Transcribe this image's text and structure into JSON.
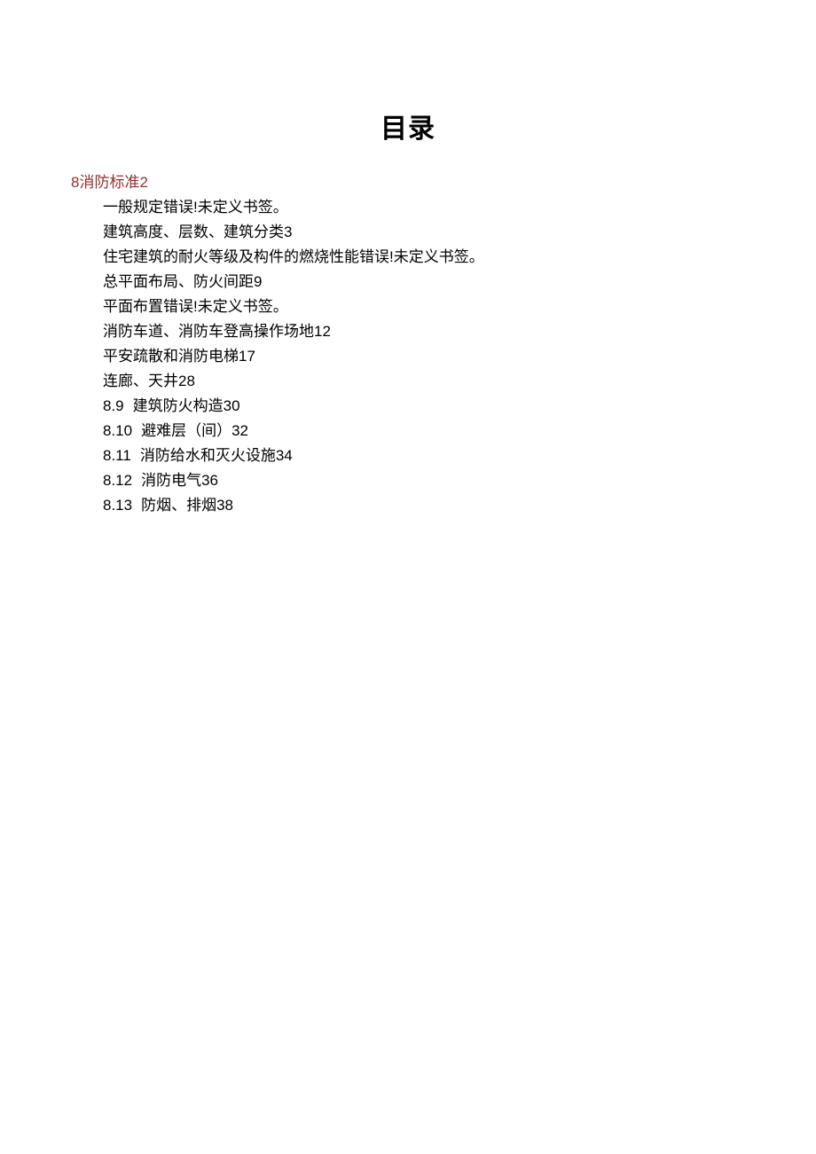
{
  "title": "目录",
  "chapter": {
    "num": "8",
    "label": "消防标准",
    "page": "2"
  },
  "entries": [
    {
      "prefix": "",
      "label": "一般规定",
      "page": "错误!未定义书签。"
    },
    {
      "prefix": "",
      "label": "建筑高度、层数、建筑分类",
      "page": "3"
    },
    {
      "prefix": "",
      "label": "住宅建筑的耐火等级及构件的燃烧性能",
      "page": "错误!未定义书签。"
    },
    {
      "prefix": "",
      "label": "总平面布局、防火间距",
      "page": "9"
    },
    {
      "prefix": "",
      "label": "平面布置",
      "page": "错误!未定义书签。"
    },
    {
      "prefix": "",
      "label": "消防车道、消防车登高操作场地",
      "page": "12"
    },
    {
      "prefix": "",
      "label": "平安疏散和消防电梯",
      "page": "17"
    },
    {
      "prefix": "",
      "label": "连廊、天井",
      "page": "28"
    },
    {
      "prefix": "8.9",
      "label": "建筑防火构造",
      "page": "30"
    },
    {
      "prefix": "8.10",
      "label": "避难层（间）",
      "page": "32"
    },
    {
      "prefix": "8.11",
      "label": "消防给水和灭火设施",
      "page": "34"
    },
    {
      "prefix": "8.12",
      "label": "消防电气",
      "page": "36"
    },
    {
      "prefix": "8.13",
      "label": "防烟、排烟",
      "page": "38"
    }
  ]
}
